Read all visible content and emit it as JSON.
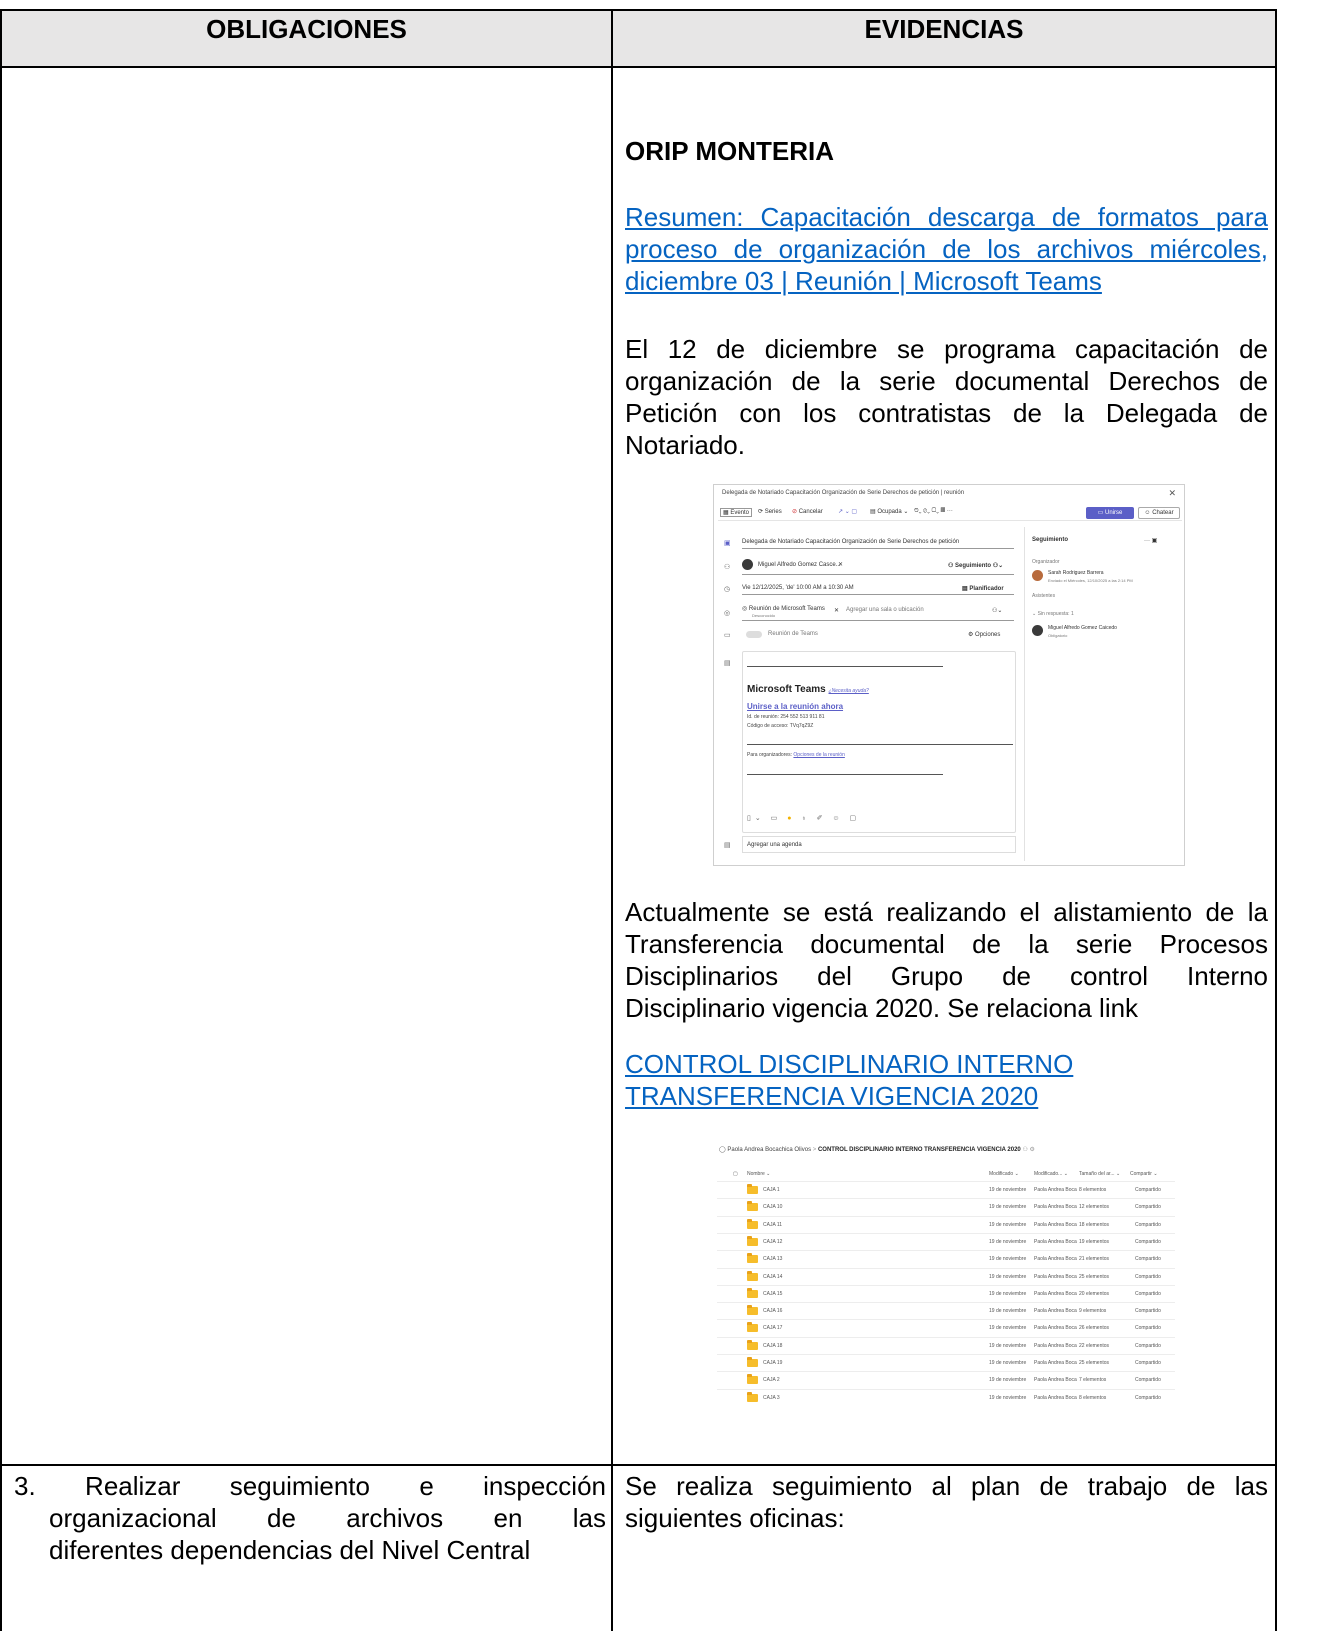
{
  "header": {
    "col1": "OBLIGACIONES",
    "col2": "EVIDENCIAS"
  },
  "evidencias": {
    "office_title": "ORIP MONTERIA",
    "link1_lines": [
      "Resumen: Capacitación descarga de formatos para",
      "proceso de organización de los archivos miércoles,",
      "diciembre 03 | Reunión | Microsoft Teams"
    ],
    "para1_lines": [
      "El 12 de diciembre se programa capacitación de",
      "organización de la serie documental Derechos de",
      "Petición con los contratistas de la Delegada de",
      "Notariado."
    ],
    "para2_lines": [
      "Actualmente se está realizando el alistamiento de la",
      "Transferencia documental de la serie Procesos",
      "Disciplinarios del Grupo de control Interno",
      "Disciplinario vigencia 2020. Se relaciona link"
    ],
    "link2_lines": [
      "CONTROL DISCIPLINARIO INTERNO",
      "TRANSFERENCIA VIGENCIA 2020"
    ]
  },
  "teams_shot": {
    "window_title": "Delegada de Notariado Capacitación Organización de Serie Derechos de petición | reunión",
    "toolbar": {
      "evento": "Evento",
      "series": "Series",
      "cancelar": "Cancelar",
      "ocupada": "Ocupada",
      "unirse": "Unirse",
      "chatear": "Chatear"
    },
    "meeting_title": "Delegada de Notariado Capacitación Organización de Serie Derechos de petición",
    "attendee_chip": "Miguel Alfredo Gomez Casce...",
    "seguimiento_btn": "Seguimiento",
    "datetime": "Vie 12/12/2025, 'de' 10:00 AM a 10:30 AM",
    "planificador": "Planificador",
    "location_chip": "Reunión de Microsoft Teams",
    "location_sub": "Desconocido",
    "location_placeholder": "Agregar una sala o ubicación",
    "teams_toggle": "Reunión de Teams",
    "opciones": "Opciones",
    "body": {
      "brand": "Microsoft Teams",
      "help": "¿Necesita ayuda?",
      "join_link": "Unirse a la reunión ahora",
      "meeting_id": "Id. de reunión: 254 552 513 911 81",
      "passcode": "Código de acceso: TVq7qZ9Z",
      "organizers_label": "Para organizadores:",
      "organizers_link": "Opciones de la reunión"
    },
    "agenda": "Agregar una agenda",
    "right": {
      "title": "Seguimiento",
      "organizer_label": "Organizador",
      "organizer_name": "Sarah Rodriguez Barrera",
      "organizer_sub": "Enviado el Miércoles, 12/10/2025 a las 2:14 PM",
      "asistentes": "Asistentes",
      "sin_respuesta": "Sin respuesta: 1",
      "attendee_name": "Miguel Alfredo Gomez Caicedo",
      "attendee_sub": "Obligatorio"
    }
  },
  "folder_shot": {
    "owner": "Paola Andrea Bocachica Olivos",
    "folder": "CONTROL DISCIPLINARIO INTERNO TRANSFERENCIA VIGENCIA 2020",
    "columns": [
      "Nombre",
      "Modificado",
      "Modificado...",
      "Tamaño del ar...",
      "Compartir"
    ],
    "rows": [
      {
        "name": "CAJA 1",
        "mod": "19 de noviembre",
        "by": "Paola Andrea Boca",
        "size": "8 elementos",
        "share": "Compartido"
      },
      {
        "name": "CAJA 10",
        "mod": "19 de noviembre",
        "by": "Paola Andrea Boca",
        "size": "12 elementos",
        "share": "Compartido"
      },
      {
        "name": "CAJA 11",
        "mod": "19 de noviembre",
        "by": "Paola Andrea Boca",
        "size": "18 elementos",
        "share": "Compartido"
      },
      {
        "name": "CAJA 12",
        "mod": "19 de noviembre",
        "by": "Paola Andrea Boca",
        "size": "19 elementos",
        "share": "Compartido"
      },
      {
        "name": "CAJA 13",
        "mod": "19 de noviembre",
        "by": "Paola Andrea Boca",
        "size": "21 elementos",
        "share": "Compartido"
      },
      {
        "name": "CAJA 14",
        "mod": "19 de noviembre",
        "by": "Paola Andrea Boca",
        "size": "25 elementos",
        "share": "Compartido"
      },
      {
        "name": "CAJA 15",
        "mod": "19 de noviembre",
        "by": "Paola Andrea Boca",
        "size": "20 elementos",
        "share": "Compartido"
      },
      {
        "name": "CAJA 16",
        "mod": "19 de noviembre",
        "by": "Paola Andrea Boca",
        "size": "9 elementos",
        "share": "Compartido"
      },
      {
        "name": "CAJA 17",
        "mod": "19 de noviembre",
        "by": "Paola Andrea Boca",
        "size": "26 elementos",
        "share": "Compartido"
      },
      {
        "name": "CAJA 18",
        "mod": "19 de noviembre",
        "by": "Paola Andrea Boca",
        "size": "22 elementos",
        "share": "Compartido"
      },
      {
        "name": "CAJA 19",
        "mod": "19 de noviembre",
        "by": "Paola Andrea Boca",
        "size": "25 elementos",
        "share": "Compartido"
      },
      {
        "name": "CAJA 2",
        "mod": "19 de noviembre",
        "by": "Paola Andrea Boca",
        "size": "7 elementos",
        "share": "Compartido"
      },
      {
        "name": "CAJA 3",
        "mod": "19 de noviembre",
        "by": "Paola Andrea Boca",
        "size": "8 elementos",
        "share": "Compartido"
      }
    ]
  },
  "row3": {
    "obligation_lines": [
      "3. Realizar seguimiento e inspección",
      "organizacional de archivos en las",
      "diferentes dependencias del Nivel Central"
    ],
    "evidence_lines": [
      "Se realiza seguimiento al plan de trabajo de las",
      "siguientes oficinas:"
    ]
  }
}
